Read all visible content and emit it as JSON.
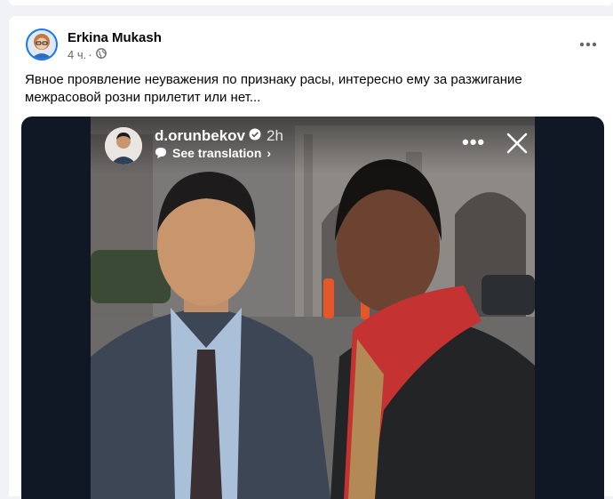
{
  "post": {
    "author": "Erkina Mukash",
    "time": "4 ч.",
    "separator": "·",
    "privacy_icon": "globe-icon",
    "more_icon": "more-dots-icon",
    "text": "Явное проявление неуважения по признаку расы, интересно ему за разжигание межрасовой розни прилетит или нет..."
  },
  "story": {
    "username": "d.orunbekov",
    "time": "2h",
    "see_translation": "See translation",
    "chevron": "›",
    "more": "•••"
  },
  "colors": {
    "accent": "#1877f2",
    "page_bg": "#f0f2f5",
    "media_bg": "#0f1824"
  }
}
